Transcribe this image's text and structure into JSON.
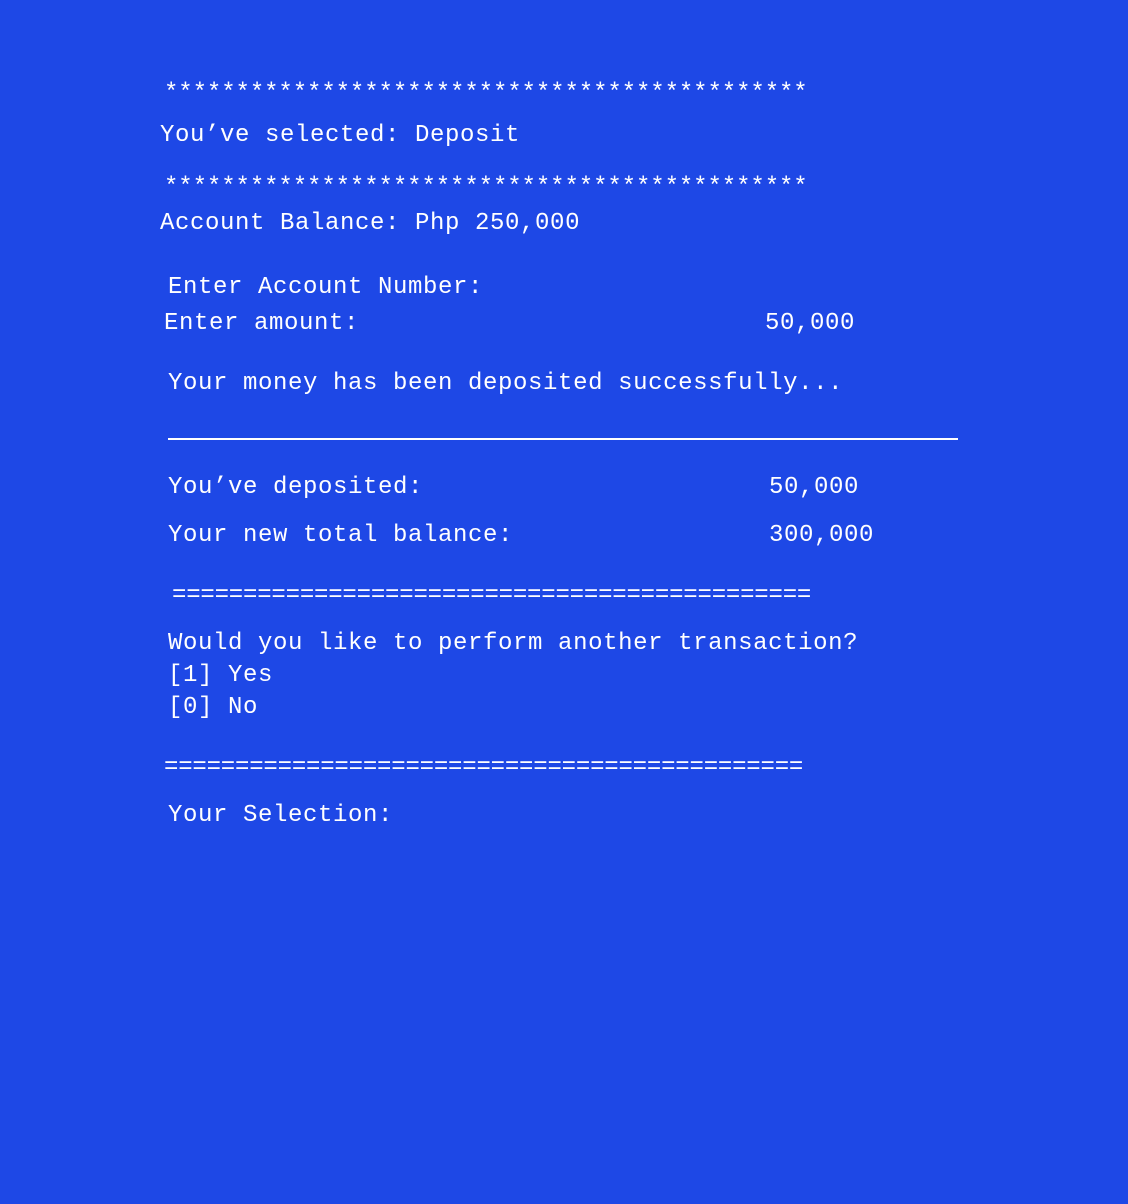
{
  "terminal": {
    "star_separator": "*********************************************",
    "selected_text": "You’ve selected: Deposit",
    "balance_text": "Account Balance: Php 250,000",
    "account_number_prompt": "Enter Account Number:",
    "amount_prompt": "Enter amount:",
    "amount_value": "50,000",
    "success_message": "Your money has been deposited successfully...",
    "deposited_label": "You’ve deposited:",
    "deposited_value": "50,000",
    "new_balance_label": "Your new total balance:",
    "new_balance_value": "300,000",
    "equals_separator": "=============================================",
    "another_transaction_prompt": "Would you like to perform another transaction?",
    "option_yes": "[1] Yes",
    "option_no": "[0] No",
    "selection_prompt": "Your Selection:"
  },
  "colors": {
    "background": "#1e48e6",
    "text": "#ffffff"
  }
}
